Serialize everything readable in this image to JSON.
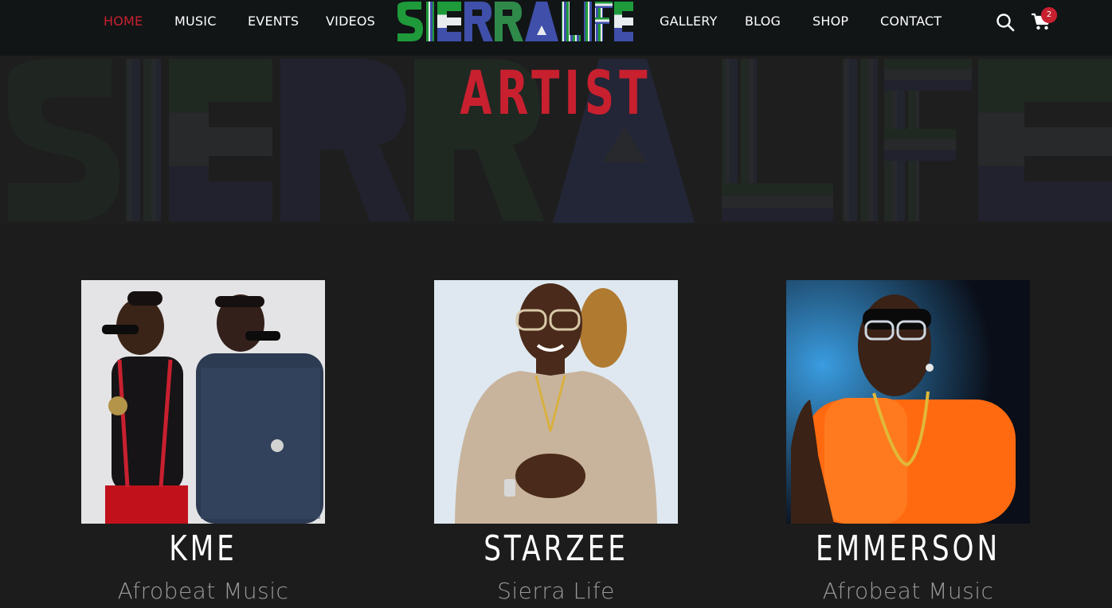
{
  "nav": {
    "left_links": [
      {
        "label": "HOME",
        "active": true
      },
      {
        "label": "MUSIC",
        "active": false
      },
      {
        "label": "EVENTS",
        "active": false
      },
      {
        "label": "VIDEOS",
        "active": false
      }
    ],
    "right_links": [
      {
        "label": "GALLERY",
        "active": false
      },
      {
        "label": "BLOG",
        "active": false
      },
      {
        "label": "SHOP",
        "active": false
      },
      {
        "label": "CONTACT",
        "active": false
      }
    ],
    "logo_text": "SIERRALIFE",
    "search_icon": "search-icon",
    "cart_icon": "cart-icon",
    "cart_count": "2"
  },
  "hero": {
    "title": "ARTIST",
    "watermark_text": "SIERRALIFE"
  },
  "artists": [
    {
      "name": "KME",
      "genre": "Afrobeat Music"
    },
    {
      "name": "STARZEE",
      "genre": "Sierra Life"
    },
    {
      "name": "EMMERSON",
      "genre": "Afrobeat Music"
    }
  ],
  "colors": {
    "accent_red": "#c8202f",
    "nav_bg": "#111516",
    "page_bg": "#1c1c1c",
    "logo_green": "#1e9a3a",
    "logo_blue": "#3f4faa",
    "logo_white": "#e8ecef"
  }
}
